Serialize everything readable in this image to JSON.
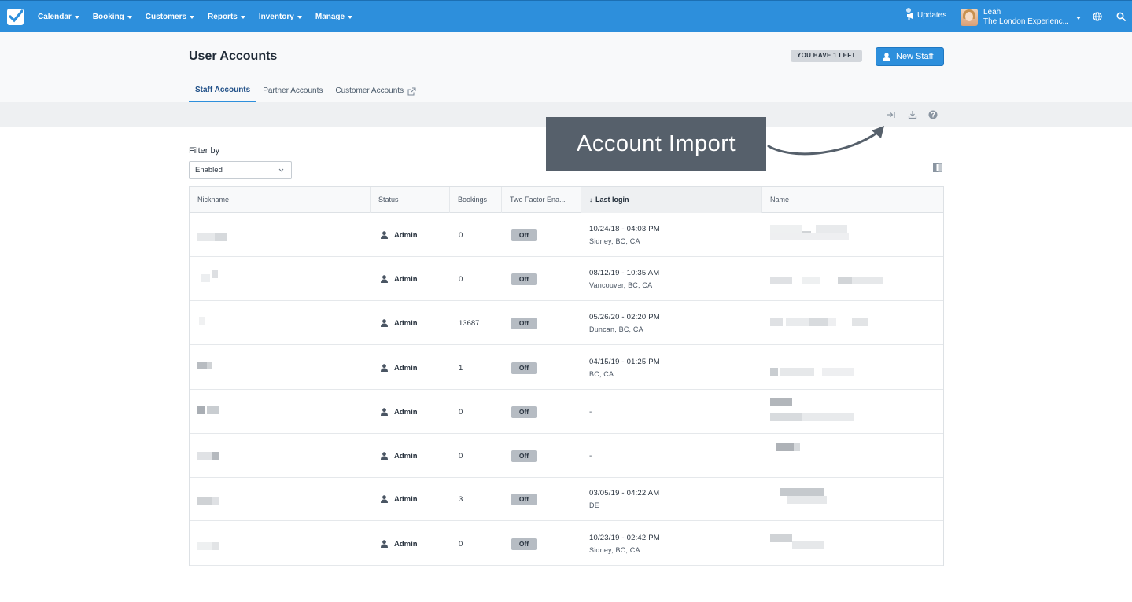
{
  "nav": {
    "items": [
      {
        "label": "Calendar"
      },
      {
        "label": "Booking"
      },
      {
        "label": "Customers"
      },
      {
        "label": "Reports"
      },
      {
        "label": "Inventory"
      },
      {
        "label": "Manage"
      }
    ],
    "updates_label": "Updates",
    "user_name": "Leah",
    "company": "The London Experienc..."
  },
  "header": {
    "title": "User Accounts",
    "quota_badge": "YOU HAVE 1 LEFT",
    "new_staff_label": "New Staff",
    "tabs": [
      {
        "label": "Staff Accounts",
        "active": true
      },
      {
        "label": "Partner Accounts",
        "active": false
      },
      {
        "label": "Customer Accounts",
        "active": false
      }
    ]
  },
  "annotation": {
    "text": "Account Import"
  },
  "filter": {
    "label": "Filter by",
    "value": "Enabled"
  },
  "table": {
    "columns": [
      "Nickname",
      "Status",
      "Bookings",
      "Two Factor Ena...",
      "Last login",
      "Name"
    ],
    "rows": [
      {
        "status": "Admin",
        "bookings": "0",
        "two_factor": "Off",
        "last_login": "10/24/18 - 04:03 PM",
        "location": "Sidney, BC, CA"
      },
      {
        "status": "Admin",
        "bookings": "0",
        "two_factor": "Off",
        "last_login": "08/12/19 - 10:35 AM",
        "location": "Vancouver, BC, CA"
      },
      {
        "status": "Admin",
        "bookings": "13687",
        "two_factor": "Off",
        "last_login": "05/26/20 - 02:20 PM",
        "location": "Duncan, BC, CA"
      },
      {
        "status": "Admin",
        "bookings": "1",
        "two_factor": "Off",
        "last_login": "04/15/19 - 01:25 PM",
        "location": "BC, CA"
      },
      {
        "status": "Admin",
        "bookings": "0",
        "two_factor": "Off",
        "last_login": "-",
        "location": ""
      },
      {
        "status": "Admin",
        "bookings": "0",
        "two_factor": "Off",
        "last_login": "-",
        "location": ""
      },
      {
        "status": "Admin",
        "bookings": "3",
        "two_factor": "Off",
        "last_login": "03/05/19 - 04:22 AM",
        "location": "DE"
      },
      {
        "status": "Admin",
        "bookings": "0",
        "two_factor": "Off",
        "last_login": "10/23/19 - 02:42 PM",
        "location": "Sidney, BC, CA"
      }
    ]
  },
  "colors": {
    "nav_bg": "#2d8fdc",
    "primary_button": "#2d8fdc",
    "annotation_bg": "#56606b",
    "off_badge": "#b6bcc3"
  },
  "icons": [
    "logo-check-icon",
    "caret-down-icon",
    "megaphone-icon",
    "globe-icon",
    "search-icon",
    "person-icon",
    "external-link-icon",
    "import-icon",
    "download-icon",
    "help-icon",
    "chevron-down-icon",
    "columns-icon",
    "sort-down-icon"
  ]
}
